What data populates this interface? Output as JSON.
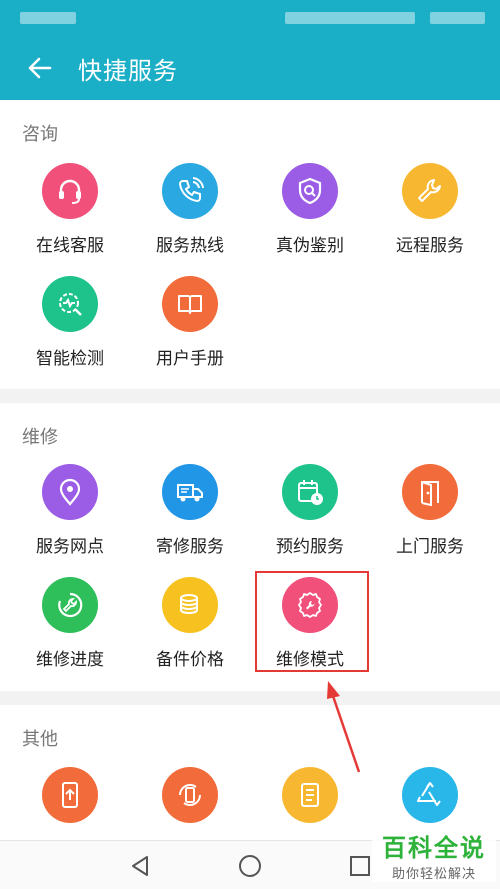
{
  "header": {
    "title": "快捷服务"
  },
  "sections": [
    {
      "label": "咨询",
      "items": [
        {
          "label": "在线客服",
          "icon": "headset-icon",
          "color": "#f0507a"
        },
        {
          "label": "服务热线",
          "icon": "phone-icon",
          "color": "#29a8e2"
        },
        {
          "label": "真伪鉴别",
          "icon": "shield-search-icon",
          "color": "#9b5de5"
        },
        {
          "label": "远程服务",
          "icon": "wrench-icon",
          "color": "#f7b731"
        },
        {
          "label": "智能检测",
          "icon": "diagnostic-icon",
          "color": "#1ec28b"
        },
        {
          "label": "用户手册",
          "icon": "book-icon",
          "color": "#f26b3a"
        }
      ]
    },
    {
      "label": "维修",
      "items": [
        {
          "label": "服务网点",
          "icon": "location-pin-icon",
          "color": "#9b5de5"
        },
        {
          "label": "寄修服务",
          "icon": "delivery-truck-icon",
          "color": "#2196e6"
        },
        {
          "label": "预约服务",
          "icon": "calendar-clock-icon",
          "color": "#1ec28b"
        },
        {
          "label": "上门服务",
          "icon": "door-icon",
          "color": "#f26b3a"
        },
        {
          "label": "维修进度",
          "icon": "repair-progress-icon",
          "color": "#2fbf5a"
        },
        {
          "label": "备件价格",
          "icon": "coins-icon",
          "color": "#f7c21f"
        },
        {
          "label": "维修模式",
          "icon": "gear-wrench-icon",
          "color": "#f0507a"
        }
      ]
    },
    {
      "label": "其他",
      "items": [
        {
          "label": "",
          "icon": "phone-upload-icon",
          "color": "#f26b3a"
        },
        {
          "label": "",
          "icon": "phone-rotate-icon",
          "color": "#f26b3a"
        },
        {
          "label": "",
          "icon": "document-icon",
          "color": "#f7b731"
        },
        {
          "label": "",
          "icon": "recycle-icon",
          "color": "#29b6e8"
        }
      ]
    }
  ],
  "watermark": {
    "title": "百科全说",
    "subtitle": "助你轻松解决"
  }
}
